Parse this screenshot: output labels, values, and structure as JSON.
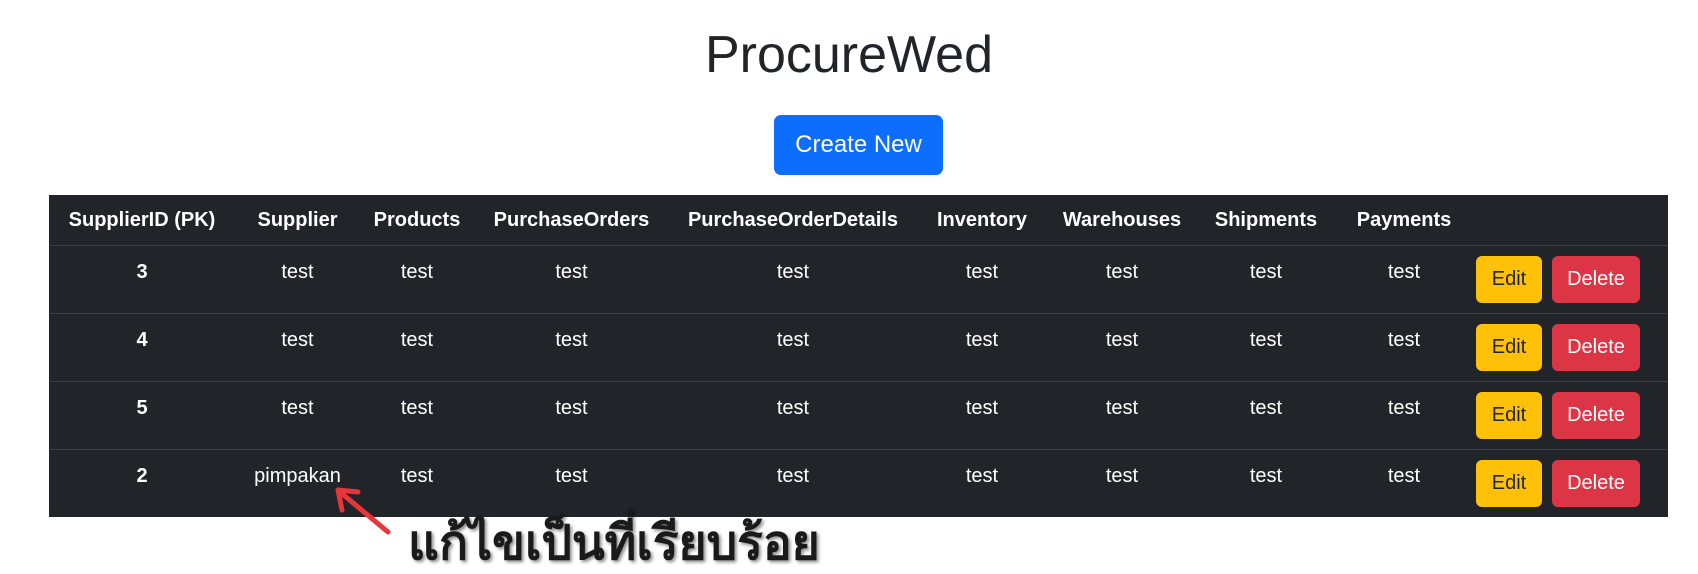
{
  "header": {
    "title": "ProcureWed"
  },
  "toolbar": {
    "create_label": "Create New"
  },
  "table": {
    "columns": [
      "SupplierID (PK)",
      "Supplier",
      "Products",
      "PurchaseOrders",
      "PurchaseOrderDetails",
      "Inventory",
      "Warehouses",
      "Shipments",
      "Payments",
      ""
    ],
    "rows": [
      {
        "id": "3",
        "supplier": "test",
        "products": "test",
        "purchase_orders": "test",
        "purchase_order_details": "test",
        "inventory": "test",
        "warehouses": "test",
        "shipments": "test",
        "payments": "test",
        "edit_label": "Edit",
        "delete_label": "Delete"
      },
      {
        "id": "4",
        "supplier": "test",
        "products": "test",
        "purchase_orders": "test",
        "purchase_order_details": "test",
        "inventory": "test",
        "warehouses": "test",
        "shipments": "test",
        "payments": "test",
        "edit_label": "Edit",
        "delete_label": "Delete"
      },
      {
        "id": "5",
        "supplier": "test",
        "products": "test",
        "purchase_orders": "test",
        "purchase_order_details": "test",
        "inventory": "test",
        "warehouses": "test",
        "shipments": "test",
        "payments": "test",
        "edit_label": "Edit",
        "delete_label": "Delete"
      },
      {
        "id": "2",
        "supplier": "pimpakan",
        "products": "test",
        "purchase_orders": "test",
        "purchase_order_details": "test",
        "inventory": "test",
        "warehouses": "test",
        "shipments": "test",
        "payments": "test",
        "edit_label": "Edit",
        "delete_label": "Delete"
      }
    ]
  },
  "annotation": {
    "text": "แก้ไขเป็นที่เรียบร้อย"
  },
  "colors": {
    "primary": "#0d6efd",
    "warning": "#ffc107",
    "danger": "#dc3545",
    "table_dark": "#212529",
    "arrow": "#e8353b"
  },
  "icons": {
    "annotation_arrow": "arrow-icon"
  }
}
